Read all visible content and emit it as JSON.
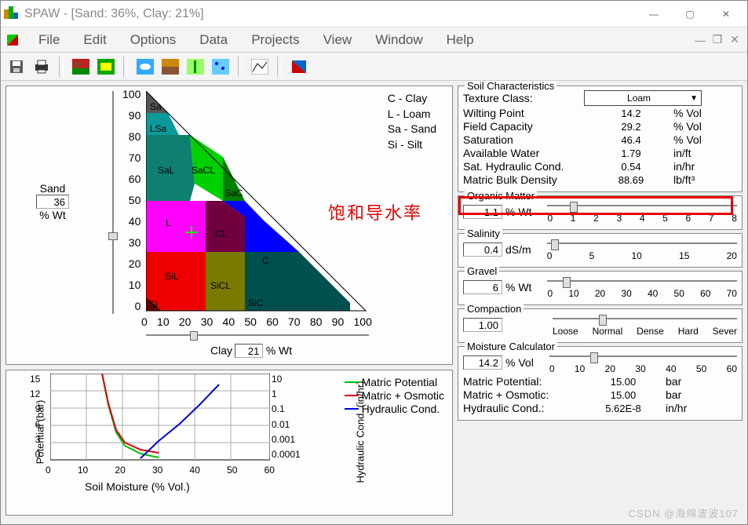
{
  "window": {
    "title": "SPAW - [Sand: 36%, Clay: 21%]"
  },
  "menu": [
    "File",
    "Edit",
    "Options",
    "Data",
    "Projects",
    "View",
    "Window",
    "Help"
  ],
  "soil_panel": {
    "sand_label": "Sand",
    "sand_value": "36",
    "sand_unit": "% Wt",
    "clay_label": "Clay",
    "clay_value": "21",
    "clay_unit": "% Wt",
    "legend": {
      "C": "C - Clay",
      "L": "L - Loam",
      "Sa": "Sa - Sand",
      "Si": "Si - Silt"
    },
    "triangle_labels": {
      "Sa": "Sa",
      "LSa": "LSa",
      "SaL": "SaL",
      "SaCL": "SaCL",
      "SaC": "SaC",
      "L": "L",
      "CL": "CL",
      "C": "C",
      "SiL": "SiL",
      "Si": "Si",
      "SiCL": "SiCL",
      "SiC": "SiC"
    },
    "y_ticks": [
      "100",
      "90",
      "80",
      "70",
      "60",
      "50",
      "40",
      "30",
      "20",
      "10",
      "0"
    ],
    "x_ticks": [
      "0",
      "10",
      "20",
      "30",
      "40",
      "50",
      "60",
      "70",
      "80",
      "90",
      "100"
    ]
  },
  "plot": {
    "legend": [
      "Matric Potential",
      "Matric + Osmotic",
      "Hydraulic Cond."
    ],
    "ylabel_left": "Potential (bar)",
    "ylabel_right": "Hydraulic Cond. (in/hr)",
    "xlabel": "Soil Moisture (% Vol.)",
    "y_left": [
      "15",
      "12",
      "9",
      "6",
      "3",
      "0"
    ],
    "y_right": [
      "10",
      "1",
      "0.1",
      "0.01",
      "0.001",
      "0.0001"
    ],
    "x_ticks": [
      "0",
      "10",
      "20",
      "30",
      "40",
      "50",
      "60"
    ]
  },
  "soil_characteristics": {
    "legend": "Soil Characteristics",
    "texture_label": "Texture Class:",
    "texture_value": "Loam",
    "rows": [
      {
        "name": "Wilting Point",
        "value": "14.2",
        "unit": "% Vol"
      },
      {
        "name": "Field Capacity",
        "value": "29.2",
        "unit": "% Vol"
      },
      {
        "name": "Saturation",
        "value": "46.4",
        "unit": "% Vol"
      },
      {
        "name": "Available Water",
        "value": "1.79",
        "unit": "in/ft"
      },
      {
        "name": "Sat. Hydraulic Cond.",
        "value": "0.54",
        "unit": "in/hr"
      },
      {
        "name": "Matric Bulk Density",
        "value": "88.69",
        "unit": "lb/ft³"
      }
    ]
  },
  "organic": {
    "legend": "Organic Matter",
    "value": "1.1",
    "unit": "% Wt",
    "ticks": [
      "0",
      "1",
      "2",
      "3",
      "4",
      "5",
      "6",
      "7",
      "8"
    ]
  },
  "salinity": {
    "legend": "Salinity",
    "value": "0.4",
    "unit": "dS/m",
    "ticks": [
      "0",
      "5",
      "10",
      "15",
      "20"
    ]
  },
  "gravel": {
    "legend": "Gravel",
    "value": "6",
    "unit": "% Wt",
    "ticks": [
      "0",
      "10",
      "20",
      "30",
      "40",
      "50",
      "60",
      "70"
    ]
  },
  "compaction": {
    "legend": "Compaction",
    "value": "1.00",
    "ticks": [
      "Loose",
      "Normal",
      "Dense",
      "Hard",
      "Sever"
    ]
  },
  "moisture": {
    "legend": "Moisture Calculator",
    "value": "14.2",
    "unit": "% Vol",
    "ticks": [
      "0",
      "10",
      "20",
      "30",
      "40",
      "50",
      "60"
    ],
    "rows": [
      {
        "name": "Matric Potential:",
        "value": "15.00",
        "unit": "bar"
      },
      {
        "name": "Matric + Osmotic:",
        "value": "15.00",
        "unit": "bar"
      },
      {
        "name": "Hydraulic Cond.:",
        "value": "5.62E-8",
        "unit": "in/hr"
      }
    ]
  },
  "annotation": {
    "text": "饱和导水率"
  },
  "watermark": {
    "text": "CSDN @海绵波波107"
  },
  "chart_data": {
    "type": "line",
    "title": "",
    "xlabel": "Soil Moisture (% Vol.)",
    "ylabel": "Potential (bar)",
    "xlim": [
      0,
      60
    ],
    "ylim_left": [
      0,
      15
    ],
    "ylim_right": [
      0.0001,
      10
    ],
    "series": [
      {
        "name": "Matric Potential",
        "color": "#00c000",
        "axis": "left",
        "x": [
          14,
          16,
          18,
          20,
          23,
          26,
          30
        ],
        "y": [
          15,
          9,
          5,
          3,
          1.5,
          0.7,
          0.3
        ]
      },
      {
        "name": "Matric + Osmotic",
        "color": "#e00000",
        "axis": "left",
        "x": [
          14,
          16,
          18,
          20,
          23,
          26,
          30
        ],
        "y": [
          15,
          9.3,
          5.3,
          3.3,
          1.8,
          1,
          0.6
        ]
      },
      {
        "name": "Hydraulic Cond.",
        "color": "#0000e0",
        "axis": "right",
        "x": [
          25,
          30,
          35,
          40,
          46
        ],
        "y": [
          0.0001,
          0.001,
          0.01,
          0.1,
          1
        ]
      }
    ]
  }
}
